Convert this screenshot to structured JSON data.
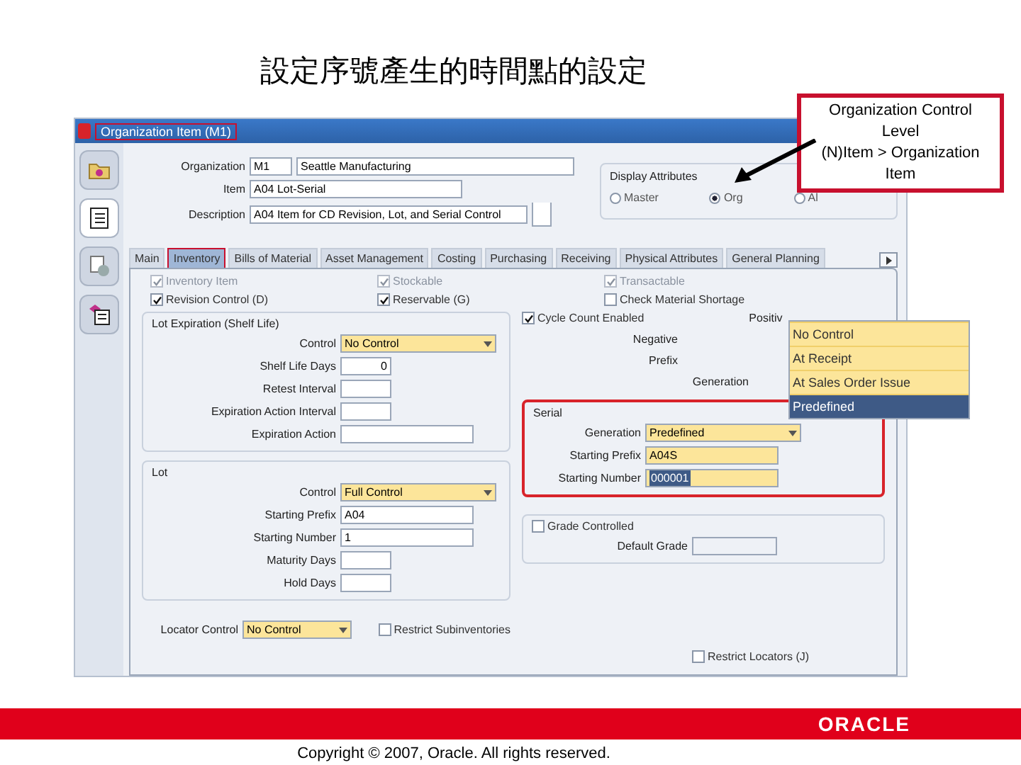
{
  "slide_title": "設定序號產生的時間點的設定",
  "callout": {
    "lines": [
      "Organization Control",
      "Level",
      "(N)Item > Organization",
      "Item"
    ]
  },
  "window": {
    "title": "Organization Item (M1)"
  },
  "header_fields": [
    {
      "label": "Organization",
      "values": [
        "M1",
        "Seattle Manufacturing"
      ]
    },
    {
      "label": "Item",
      "values": [
        "A04 Lot-Serial"
      ]
    },
    {
      "label": "Description",
      "values": [
        "A04 Item for CD Revision, Lot, and Serial Control"
      ]
    }
  ],
  "display_attributes": {
    "label": "Display Attributes",
    "options": [
      {
        "label": "Master",
        "selected": false
      },
      {
        "label": "Org",
        "selected": true
      },
      {
        "label": "Al",
        "selected": false
      }
    ]
  },
  "tabs": [
    {
      "label": "Main",
      "selected": false
    },
    {
      "label": "Inventory",
      "selected": true
    },
    {
      "label": "Bills of Material",
      "selected": false
    },
    {
      "label": "Asset Management",
      "selected": false
    },
    {
      "label": "Costing",
      "selected": false
    },
    {
      "label": "Purchasing",
      "selected": false
    },
    {
      "label": "Receiving",
      "selected": false
    },
    {
      "label": "Physical Attributes",
      "selected": false
    },
    {
      "label": "General Planning",
      "selected": false
    }
  ],
  "checkboxes": [
    {
      "label": "Inventory Item",
      "checked": true,
      "disabled": true
    },
    {
      "label": "Stockable",
      "checked": true,
      "disabled": true
    },
    {
      "label": "Transactable",
      "checked": true,
      "disabled": true
    },
    {
      "label": "Revision Control (D)",
      "checked": true,
      "disabled": false
    },
    {
      "label": "Reservable (G)",
      "checked": true,
      "disabled": false
    },
    {
      "label": "Check Material Shortage",
      "checked": false,
      "disabled": false
    }
  ],
  "lot_expiration": {
    "title": "Lot Expiration (Shelf Life)",
    "fields": [
      {
        "label": "Control",
        "kind": "select",
        "value": "No Control"
      },
      {
        "label": "Shelf Life Days",
        "kind": "number",
        "value": "0"
      },
      {
        "label": "Retest Interval",
        "kind": "short"
      },
      {
        "label": "Expiration Action Interval",
        "kind": "short"
      },
      {
        "label": "Expiration Action",
        "kind": "long"
      }
    ]
  },
  "lot": {
    "title": "Lot",
    "fields": [
      {
        "label": "Control",
        "kind": "select",
        "value": "Full Control"
      },
      {
        "label": "Starting Prefix",
        "kind": "long",
        "value": "A04"
      },
      {
        "label": "Starting Number",
        "kind": "long",
        "value": "1"
      },
      {
        "label": "Maturity Days",
        "kind": "short"
      },
      {
        "label": "Hold Days",
        "kind": "short"
      }
    ]
  },
  "locator": {
    "label": "Locator Control",
    "value": "No Control"
  },
  "restrict": [
    {
      "label": "Restrict Subinventories",
      "checked": false
    },
    {
      "label": "Restrict Locators (J)",
      "checked": false
    }
  ],
  "cycle_count": {
    "label": "Cycle Count Enabled",
    "checked": true
  },
  "positive_label": "Positiv",
  "overlay_labels": [
    "Negative",
    "Prefix",
    "Generation"
  ],
  "dropdown_options": [
    {
      "label": "No Control",
      "selected": false
    },
    {
      "label": "At Receipt",
      "selected": false
    },
    {
      "label": "At Sales Order Issue",
      "selected": false
    },
    {
      "label": "Predefined",
      "selected": true
    }
  ],
  "serial": {
    "title": "Serial",
    "fields": [
      {
        "label": "Generation",
        "kind": "select",
        "value": "Predefined"
      },
      {
        "label": "Starting Prefix",
        "kind": "required",
        "value": "A04S"
      },
      {
        "label": "Starting Number",
        "kind": "highlight",
        "value": "000001"
      }
    ]
  },
  "grade": {
    "label": "Grade Controlled",
    "checked": false,
    "field_label": "Default Grade"
  },
  "footer": {
    "logo": "ORACLE",
    "copyright": "Copyright © 2007, Oracle. All rights reserved."
  }
}
